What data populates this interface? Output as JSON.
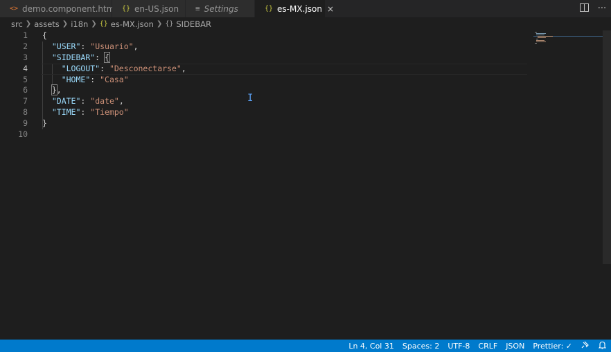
{
  "tabs": [
    {
      "label": "demo.component.html",
      "icon": "html-icon",
      "icon_glyph": "<>"
    },
    {
      "label": "en-US.json",
      "icon": "json-icon",
      "icon_glyph": "{}"
    },
    {
      "label": "Settings",
      "icon": "settings-icon",
      "icon_glyph": "≡"
    },
    {
      "label": "es-MX.json",
      "icon": "json-icon",
      "icon_glyph": "{}",
      "active": true,
      "close": "×"
    }
  ],
  "tab_actions": {
    "split": "split-editor-icon",
    "more": "···"
  },
  "breadcrumb": {
    "items": [
      "src",
      "assets",
      "i18n"
    ],
    "file": "es-MX.json",
    "file_glyph": "{}",
    "symbol": "SIDEBAR",
    "symbol_glyph": "{}"
  },
  "editor": {
    "line_numbers": [
      "1",
      "2",
      "3",
      "4",
      "5",
      "6",
      "7",
      "8",
      "9",
      "10"
    ],
    "lines": {
      "l1_open": "{",
      "l2_key": "\"USER\"",
      "l2_val": "\"Usuario\"",
      "l3_key": "\"SIDEBAR\"",
      "l3_brace": "{",
      "l4_key": "\"LOGOUT\"",
      "l4_val": "\"Desconectarse\"",
      "l5_key": "\"HOME\"",
      "l5_val": "\"Casa\"",
      "l6_close": "}",
      "l7_key": "\"DATE\"",
      "l7_val": "\"date\"",
      "l8_key": "\"TIME\"",
      "l8_val": "\"Tiempo\"",
      "l9_close": "}"
    }
  },
  "statusbar": {
    "position": "Ln 4, Col 31",
    "spaces": "Spaces: 2",
    "encoding": "UTF-8",
    "eol": "CRLF",
    "language": "JSON",
    "formatter": "Prettier: ✓"
  },
  "colors": {
    "accent": "#007acc",
    "key": "#9cdcfe",
    "string": "#ce9178",
    "json_icon": "#cbcb41",
    "html_icon": "#e37933"
  }
}
